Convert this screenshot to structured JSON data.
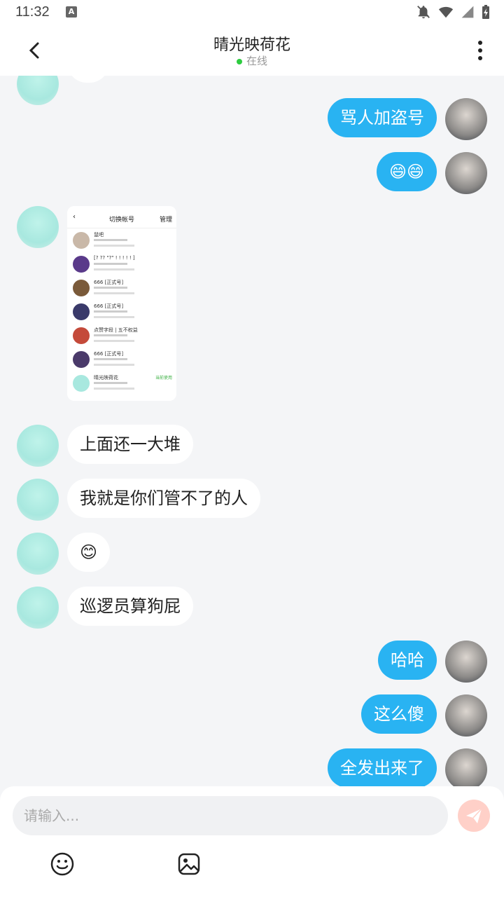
{
  "status": {
    "time": "11:32",
    "a_icon": "A"
  },
  "header": {
    "title": "晴光映荷花",
    "status_text": "在线"
  },
  "shared_screenshot": {
    "title": "切换帐号",
    "right": "管理",
    "rows": [
      {
        "name": "鼠吧",
        "tag": ""
      },
      {
        "name": "[? ?? \"?\" ! ! ! ! ! ]",
        "tag": ""
      },
      {
        "name": "666 [正式号]",
        "tag": ""
      },
      {
        "name": "666 [正式号]",
        "tag": ""
      },
      {
        "name": "点赞字段 | 五不权益",
        "tag": ""
      },
      {
        "name": "666 [正式号]",
        "tag": ""
      },
      {
        "name": "晴光映荷花",
        "tag": "当前使用"
      }
    ]
  },
  "messages": [
    {
      "side": "out",
      "text": "骂人加盗号"
    },
    {
      "side": "out",
      "text": "😄😄"
    },
    {
      "side": "in",
      "text": "上面还一大堆"
    },
    {
      "side": "in",
      "text": "我就是你们管不了的人"
    },
    {
      "side": "in",
      "text": "😊"
    },
    {
      "side": "in",
      "text": "巡逻员算狗屁"
    },
    {
      "side": "out",
      "text": "哈哈"
    },
    {
      "side": "out",
      "text": "这么傻"
    },
    {
      "side": "out",
      "text": "全发出来了"
    }
  ],
  "composer": {
    "placeholder": "请输入..."
  },
  "icons": {
    "back": "back-arrow-icon",
    "more": "more-vertical-icon",
    "send": "send-icon",
    "emoji": "emoji-icon",
    "image": "image-icon"
  },
  "colors": {
    "accent": "#29b3f2",
    "online": "#2ecc40",
    "send": "#ffd0c8"
  }
}
